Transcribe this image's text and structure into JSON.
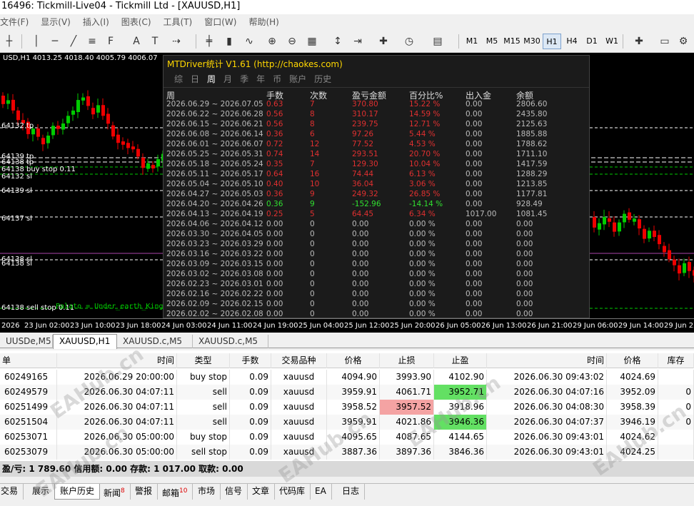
{
  "titlebar": {
    "text": "16496: Tickmill-Live04 - Tickmill Ltd - [XAUUSD,H1]"
  },
  "menu": [
    "文件(F)",
    "显示(V)",
    "插入(I)",
    "图表(C)",
    "工具(T)",
    "窗口(W)",
    "帮助(H)"
  ],
  "timeframes": [
    "M1",
    "M5",
    "M15",
    "M30",
    "H1",
    "H4",
    "D1",
    "W1"
  ],
  "selected_timeframe": "H1",
  "chart": {
    "symbol_info": "USD,H1  4013.25 4018.40 4005.79 4006.07",
    "levels": [
      "64132 tp",
      "64139 tp",
      "64138 tp",
      "64138 buy stop 0.11",
      "64132 sl",
      "64139 sl",
      "64137 sl",
      "64138 sl",
      "64138 sl",
      "64138 sell stop 0.11"
    ],
    "comment": "Palato = Under_earth_King",
    "bull_color": "#00cc00",
    "bear_color": "#ee0000"
  },
  "time_axis": [
    "2026",
    "23 Jun 02:00",
    "23 Jun 10:00",
    "23 Jun 18:00",
    "24 Jun 03:00",
    "24 Jun 11:00",
    "24 Jun 19:00",
    "25 Jun 04:00",
    "25 Jun 12:00",
    "25 Jun 20:00",
    "26 Jun 05:00",
    "26 Jun 13:00",
    "26 Jun 21:00",
    "29 Jun 06:00",
    "29 Jun 14:00",
    "29 Jun 22"
  ],
  "chart_tabs": [
    "UUSDe,M5",
    "XAUUSD,H1",
    "XAUUSD.c,M5",
    "XAUUSD.c,M5"
  ],
  "active_chart_tab": "XAUUSD,H1",
  "overlay": {
    "title": "MTDriver统计 V1.61  (http://chaokes.com)",
    "tabs": [
      "综",
      "日",
      "周",
      "月",
      "季",
      "年",
      "币",
      "账户",
      "历史"
    ],
    "active_tab": "周",
    "columns": [
      "周",
      "手数",
      "次数",
      "盈亏金额",
      "百分比%",
      "出入金",
      "余额"
    ],
    "rows": [
      [
        "2026.06.29 ~ 2026.07.05",
        "0.63",
        "7",
        "370.80",
        "15.22 %",
        "0.00",
        "2806.60",
        "red"
      ],
      [
        "2026.06.22 ~ 2026.06.28",
        "0.56",
        "8",
        "310.17",
        "14.59 %",
        "0.00",
        "2435.80",
        "red"
      ],
      [
        "2026.06.15 ~ 2026.06.21",
        "0.56",
        "8",
        "239.75",
        "12.71 %",
        "0.00",
        "2125.63",
        "red"
      ],
      [
        "2026.06.08 ~ 2026.06.14",
        "0.36",
        "6",
        "97.26",
        "5.44 %",
        "0.00",
        "1885.88",
        "red"
      ],
      [
        "2026.06.01 ~ 2026.06.07",
        "0.72",
        "12",
        "77.52",
        "4.53 %",
        "0.00",
        "1788.62",
        "red"
      ],
      [
        "2026.05.25 ~ 2026.05.31",
        "0.74",
        "14",
        "293.51",
        "20.70 %",
        "0.00",
        "1711.10",
        "red"
      ],
      [
        "2026.05.18 ~ 2026.05.24",
        "0.35",
        "7",
        "129.30",
        "10.04 %",
        "0.00",
        "1417.59",
        "red"
      ],
      [
        "2026.05.11 ~ 2026.05.17",
        "0.64",
        "16",
        "74.44",
        "6.13 %",
        "0.00",
        "1288.29",
        "red"
      ],
      [
        "2026.05.04 ~ 2026.05.10",
        "0.40",
        "10",
        "36.04",
        "3.06 %",
        "0.00",
        "1213.85",
        "red"
      ],
      [
        "2026.04.27 ~ 2026.05.03",
        "0.36",
        "9",
        "249.32",
        "26.85 %",
        "0.00",
        "1177.81",
        "red"
      ],
      [
        "2026.04.20 ~ 2026.04.26",
        "0.36",
        "9",
        "-152.96",
        "-14.14 %",
        "0.00",
        "928.49",
        "green"
      ],
      [
        "2026.04.13 ~ 2026.04.19",
        "0.25",
        "5",
        "64.45",
        "6.34 %",
        "1017.00",
        "1081.45",
        "red"
      ],
      [
        "2026.04.06 ~ 2026.04.12",
        "0.00",
        "0",
        "0.00",
        "0.00 %",
        "0.00",
        "0.00",
        "gray"
      ],
      [
        "2026.03.30 ~ 2026.04.05",
        "0.00",
        "0",
        "0.00",
        "0.00 %",
        "0.00",
        "0.00",
        "gray"
      ],
      [
        "2026.03.23 ~ 2026.03.29",
        "0.00",
        "0",
        "0.00",
        "0.00 %",
        "0.00",
        "0.00",
        "gray"
      ],
      [
        "2026.03.16 ~ 2026.03.22",
        "0.00",
        "0",
        "0.00",
        "0.00 %",
        "0.00",
        "0.00",
        "gray"
      ],
      [
        "2026.03.09 ~ 2026.03.15",
        "0.00",
        "0",
        "0.00",
        "0.00 %",
        "0.00",
        "0.00",
        "gray"
      ],
      [
        "2026.03.02 ~ 2026.03.08",
        "0.00",
        "0",
        "0.00",
        "0.00 %",
        "0.00",
        "0.00",
        "gray"
      ],
      [
        "2026.02.23 ~ 2026.03.01",
        "0.00",
        "0",
        "0.00",
        "0.00 %",
        "0.00",
        "0.00",
        "gray"
      ],
      [
        "2026.02.16 ~ 2026.02.22",
        "0.00",
        "0",
        "0.00",
        "0.00 %",
        "0.00",
        "0.00",
        "gray"
      ],
      [
        "2026.02.09 ~ 2026.02.15",
        "0.00",
        "0",
        "0.00",
        "0.00 %",
        "0.00",
        "0.00",
        "gray"
      ],
      [
        "2026.02.02 ~ 2026.02.08",
        "0.00",
        "0",
        "0.00",
        "0.00 %",
        "0.00",
        "0.00",
        "gray"
      ]
    ]
  },
  "history": {
    "columns": [
      "单",
      "时间",
      "类型",
      "手数",
      "交易品种",
      "价格",
      "止损",
      "止盈",
      "时间",
      "价格",
      "库存"
    ],
    "rows": [
      {
        "ticket": "60249165",
        "open_time": "2026.06.29 20:00:00",
        "type": "buy stop",
        "lots": "0.09",
        "symbol": "xauusd",
        "price": "4094.90",
        "sl": "3993.90",
        "tp": "4102.90",
        "close_time": "2026.06.30 09:43:02",
        "close_price": "4024.69",
        "swap": "",
        "sl_hl": "",
        "tp_hl": ""
      },
      {
        "ticket": "60249579",
        "open_time": "2026.06.30 04:07:11",
        "type": "sell",
        "lots": "0.09",
        "symbol": "xauusd",
        "price": "3959.91",
        "sl": "4061.71",
        "tp": "3952.71",
        "close_time": "2026.06.30 04:07:16",
        "close_price": "3952.09",
        "swap": "0",
        "sl_hl": "",
        "tp_hl": "green"
      },
      {
        "ticket": "60251499",
        "open_time": "2026.06.30 04:07:11",
        "type": "sell",
        "lots": "0.09",
        "symbol": "xauusd",
        "price": "3958.52",
        "sl": "3957.52",
        "tp": "3918.96",
        "close_time": "2026.06.30 04:08:30",
        "close_price": "3958.39",
        "swap": "0",
        "sl_hl": "red",
        "tp_hl": ""
      },
      {
        "ticket": "60251504",
        "open_time": "2026.06.30 04:07:11",
        "type": "sell",
        "lots": "0.09",
        "symbol": "xauusd",
        "price": "3959.91",
        "sl": "4021.86",
        "tp": "3946.36",
        "close_time": "2026.06.30 04:07:37",
        "close_price": "3946.19",
        "swap": "0",
        "sl_hl": "",
        "tp_hl": "green"
      },
      {
        "ticket": "60253071",
        "open_time": "2026.06.30 05:00:00",
        "type": "buy stop",
        "lots": "0.09",
        "symbol": "xauusd",
        "price": "4095.65",
        "sl": "4087.65",
        "tp": "4144.65",
        "close_time": "2026.06.30 09:43:01",
        "close_price": "4024.62",
        "swap": "",
        "sl_hl": "",
        "tp_hl": ""
      },
      {
        "ticket": "60253079",
        "open_time": "2026.06.30 05:00:00",
        "type": "sell stop",
        "lots": "0.09",
        "symbol": "xauusd",
        "price": "3887.36",
        "sl": "3897.36",
        "tp": "3846.36",
        "close_time": "2026.06.30 09:43:01",
        "close_price": "4024.25",
        "swap": "",
        "sl_hl": "",
        "tp_hl": ""
      }
    ]
  },
  "balance_line": "盈/亏: 1 789.60  信用额: 0.00  存款: 1 017.00  取款: 0.00",
  "bottom_tabs": [
    {
      "label": "交易",
      "badge": ""
    },
    {
      "label": "展示",
      "badge": ""
    },
    {
      "label": "账户历史",
      "badge": ""
    },
    {
      "label": "新闻",
      "badge": "8"
    },
    {
      "label": "警报",
      "badge": ""
    },
    {
      "label": "邮箱",
      "badge": "10"
    },
    {
      "label": "市场",
      "badge": ""
    },
    {
      "label": "信号",
      "badge": ""
    },
    {
      "label": "文章",
      "badge": ""
    },
    {
      "label": "代码库",
      "badge": ""
    },
    {
      "label": "EA",
      "badge": ""
    },
    {
      "label": "日志",
      "badge": ""
    }
  ],
  "active_bottom_tab": "账户历史",
  "watermark": "EAHub.cn"
}
